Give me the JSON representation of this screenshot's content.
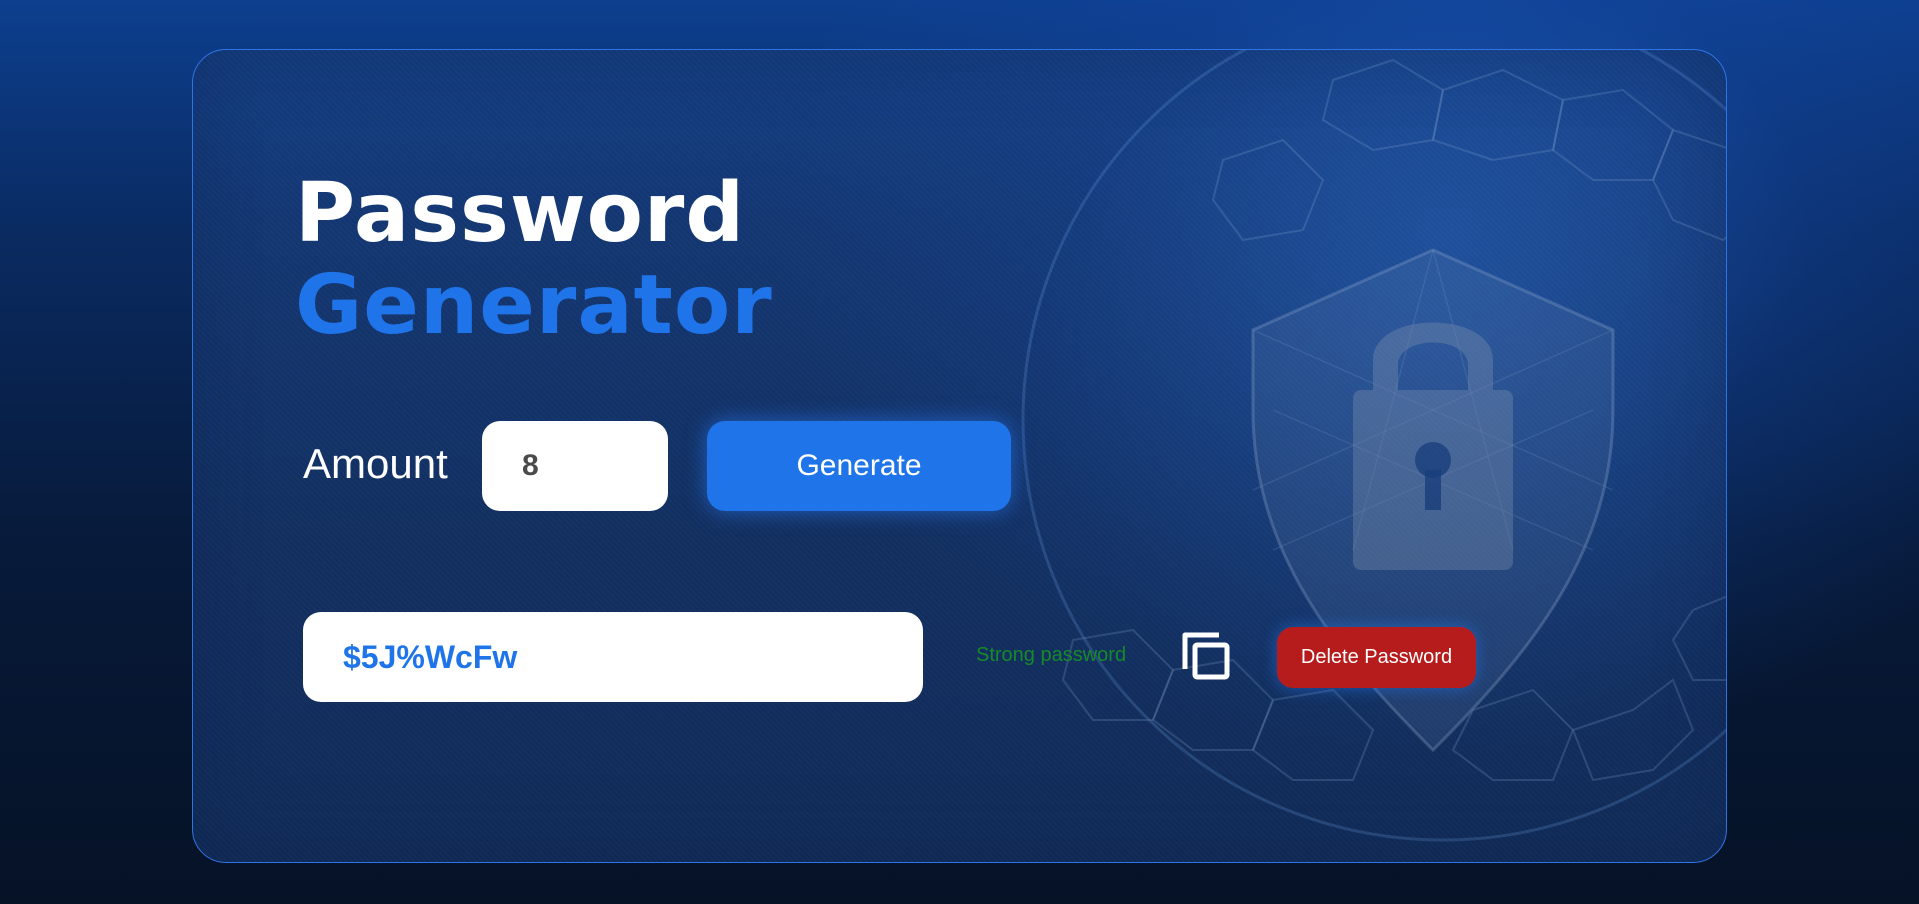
{
  "header": {
    "title_line1": "Password",
    "title_line2": "Generator"
  },
  "controls": {
    "amount_label": "Amount",
    "amount_value": "8",
    "generate_label": "Generate"
  },
  "output": {
    "password": "$5J%WcFw",
    "strength": "Strong password",
    "copy_icon": "copy-icon",
    "delete_label": "Delete Password"
  },
  "colors": {
    "accent": "#1e74e8",
    "danger": "#b71c1c",
    "success": "#168a2a",
    "card": "#1c4282"
  },
  "decoration": {
    "icon": "shield-lock-icon"
  }
}
